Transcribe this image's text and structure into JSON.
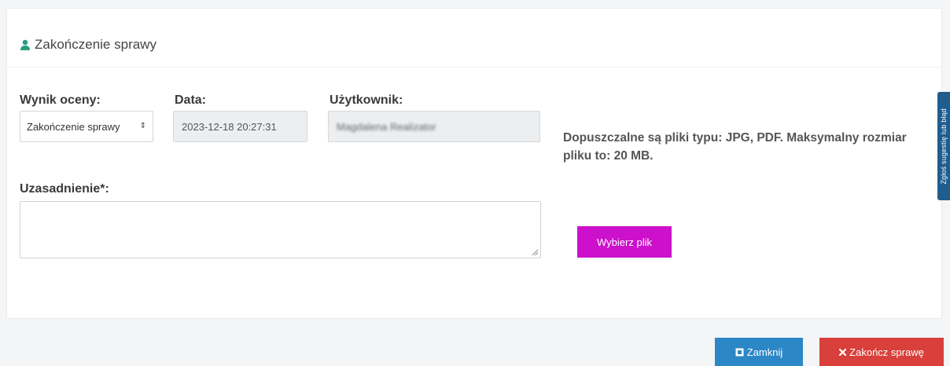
{
  "panel": {
    "title": "Zakończenie sprawy",
    "title_icon": "user-icon"
  },
  "form": {
    "result_label": "Wynik oceny:",
    "result_value": "Zakończenie sprawy",
    "date_label": "Data:",
    "date_value": "2023-12-18 20:27:31",
    "user_label": "Użytkownik:",
    "user_value": "Magdalena Realizator",
    "reason_label": "Uzasadnienie*:",
    "reason_value": ""
  },
  "upload": {
    "info": "Dopuszczalne są pliki typu: JPG, PDF. Maksymalny rozmiar pliku to: 20 MB.",
    "button_label": "Wybierz plik",
    "button_color": "#cc10cc"
  },
  "feedback_tab": {
    "label": "Zgłoś sugestię lub błąd"
  },
  "footer": {
    "close_label": "Zamknij",
    "close_color": "#2b87c6",
    "finish_label": "Zakończ sprawę",
    "finish_color": "#d9403b"
  }
}
